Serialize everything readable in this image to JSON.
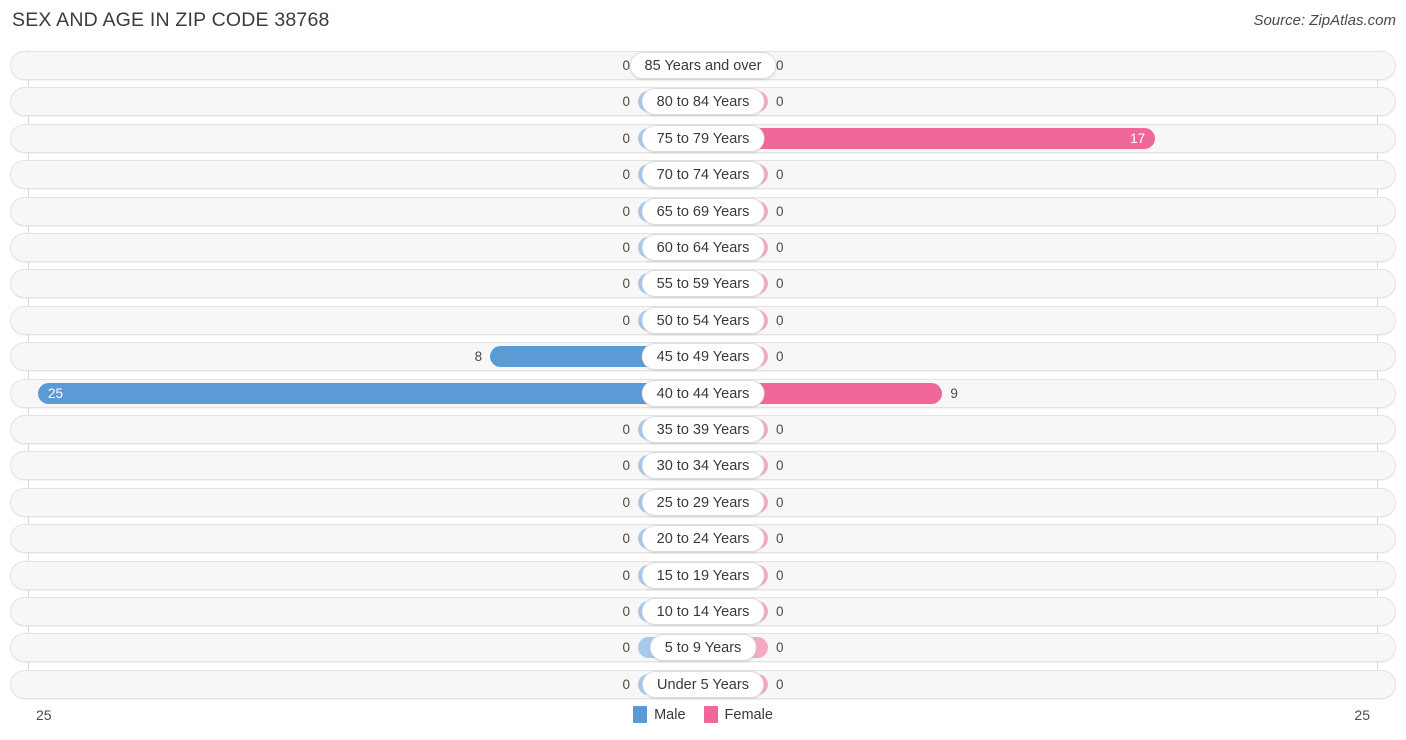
{
  "header": {
    "title": "SEX AND AGE IN ZIP CODE 38768",
    "source": "Source: ZipAtlas.com"
  },
  "legend": {
    "male_label": "Male",
    "female_label": "Female",
    "male_color": "#5b9bd5",
    "female_color": "#f2679a"
  },
  "axis": {
    "left_label": "25",
    "right_label": "25"
  },
  "colors": {
    "male": "#5b9bd5",
    "male_zero": "#a8c8ec",
    "female": "#f2679a",
    "female_zero": "#f7a8c0",
    "track": "#f7f7f7",
    "track_border": "#e3e3e3",
    "gridline": "#d9d9d9"
  },
  "chart_data": {
    "type": "bar",
    "title": "SEX AND AGE IN ZIP CODE 38768",
    "subtitle": "Source: ZipAtlas.com",
    "orientation": "horizontal",
    "layout": "population-pyramid",
    "xlabel": "",
    "ylabel": "",
    "xlim": [
      -25,
      25
    ],
    "axis_max": 25,
    "grid": true,
    "legend_position": "bottom-center",
    "categories": [
      "85 Years and over",
      "80 to 84 Years",
      "75 to 79 Years",
      "70 to 74 Years",
      "65 to 69 Years",
      "60 to 64 Years",
      "55 to 59 Years",
      "50 to 54 Years",
      "45 to 49 Years",
      "40 to 44 Years",
      "35 to 39 Years",
      "30 to 34 Years",
      "25 to 29 Years",
      "20 to 24 Years",
      "15 to 19 Years",
      "10 to 14 Years",
      "5 to 9 Years",
      "Under 5 Years"
    ],
    "series": [
      {
        "name": "Male",
        "color": "#5b9bd5",
        "values": [
          0,
          0,
          0,
          0,
          0,
          0,
          0,
          0,
          8,
          25,
          0,
          0,
          0,
          0,
          0,
          0,
          0,
          0
        ]
      },
      {
        "name": "Female",
        "color": "#f2679a",
        "values": [
          0,
          0,
          17,
          0,
          0,
          0,
          0,
          0,
          0,
          9,
          0,
          0,
          0,
          0,
          0,
          0,
          0,
          0
        ]
      }
    ]
  },
  "rows": [
    {
      "label": "85 Years and over",
      "male": "0",
      "female": "0"
    },
    {
      "label": "80 to 84 Years",
      "male": "0",
      "female": "0"
    },
    {
      "label": "75 to 79 Years",
      "male": "0",
      "female": "17"
    },
    {
      "label": "70 to 74 Years",
      "male": "0",
      "female": "0"
    },
    {
      "label": "65 to 69 Years",
      "male": "0",
      "female": "0"
    },
    {
      "label": "60 to 64 Years",
      "male": "0",
      "female": "0"
    },
    {
      "label": "55 to 59 Years",
      "male": "0",
      "female": "0"
    },
    {
      "label": "50 to 54 Years",
      "male": "0",
      "female": "0"
    },
    {
      "label": "45 to 49 Years",
      "male": "8",
      "female": "0"
    },
    {
      "label": "40 to 44 Years",
      "male": "25",
      "female": "9"
    },
    {
      "label": "35 to 39 Years",
      "male": "0",
      "female": "0"
    },
    {
      "label": "30 to 34 Years",
      "male": "0",
      "female": "0"
    },
    {
      "label": "25 to 29 Years",
      "male": "0",
      "female": "0"
    },
    {
      "label": "20 to 24 Years",
      "male": "0",
      "female": "0"
    },
    {
      "label": "15 to 19 Years",
      "male": "0",
      "female": "0"
    },
    {
      "label": "10 to 14 Years",
      "male": "0",
      "female": "0"
    },
    {
      "label": "5 to 9 Years",
      "male": "0",
      "female": "0"
    },
    {
      "label": "Under 5 Years",
      "male": "0",
      "female": "0"
    }
  ]
}
